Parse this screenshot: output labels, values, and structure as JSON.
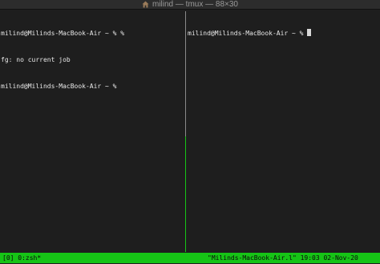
{
  "window": {
    "title": "milind — tmux — 88×30"
  },
  "panes": {
    "left": {
      "lines": [
        "milind@Milinds-MacBook-Air ~ % %",
        "fg: no current job",
        "milind@Milinds-MacBook-Air ~ % "
      ]
    },
    "right": {
      "prompt": "milind@Milinds-MacBook-Air ~ % "
    }
  },
  "status_bar": {
    "left": "[0] 0:zsh*",
    "right": "\"Milinds-MacBook-Air.l\" 19:03 02-Nov-20"
  },
  "colors": {
    "background": "#1e1e1e",
    "text": "#e8e8e8",
    "status_bar": "#16c416",
    "active_border": "#16c416",
    "inactive_border": "#8a8a8a"
  },
  "icons": {
    "title": "home-icon",
    "cursor": "block-cursor"
  }
}
